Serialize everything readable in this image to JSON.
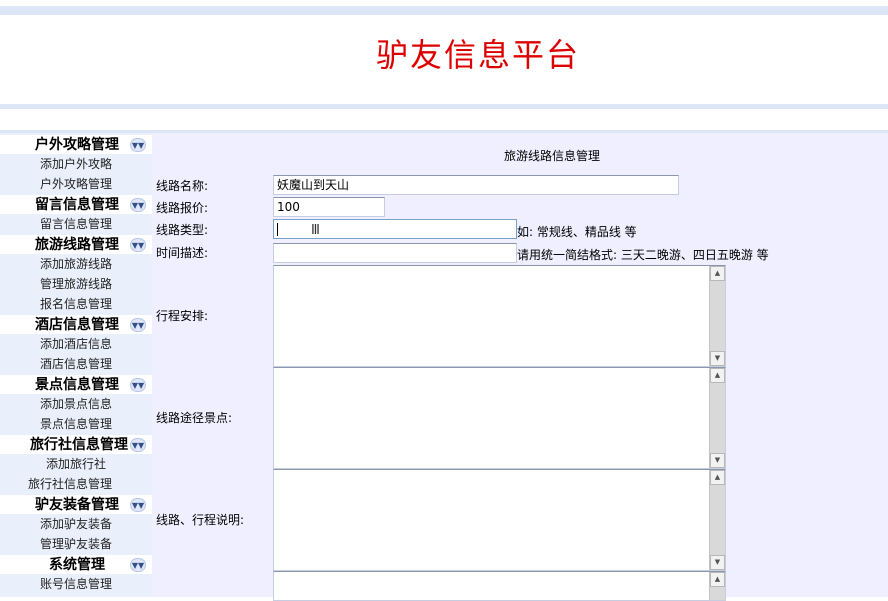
{
  "header": {
    "title": "驴友信息平台"
  },
  "sidebar": {
    "groups": [
      {
        "title": "户外攻略管理",
        "items": [
          "添加户外攻略",
          "户外攻略管理"
        ]
      },
      {
        "title": "留言信息管理",
        "items": [
          "留言信息管理"
        ]
      },
      {
        "title": "旅游线路管理",
        "items": [
          "添加旅游线路",
          "管理旅游线路",
          "报名信息管理"
        ]
      },
      {
        "title": "酒店信息管理",
        "items": [
          "添加酒店信息",
          "酒店信息管理"
        ]
      },
      {
        "title": "景点信息管理",
        "items": [
          "添加景点信息",
          "景点信息管理"
        ]
      },
      {
        "title": "旅行社信息管理",
        "items": [
          "添加旅行社",
          "旅行社信息管理"
        ]
      },
      {
        "title": "驴友装备管理",
        "items": [
          "添加驴友装备",
          "管理驴友装备"
        ]
      },
      {
        "title": "系统管理",
        "items": [
          "账号信息管理"
        ]
      }
    ],
    "toggle_icon": "double-chevron-down-icon"
  },
  "form": {
    "title": "旅游线路信息管理",
    "route_name_label": "线路名称:",
    "route_name_value": "妖魔山到天山",
    "price_label": "线路报价:",
    "price_value": "100",
    "type_label": "线路类型:",
    "type_value": "",
    "type_hint": "如: 常规线、精品线 等",
    "time_label": "时间描述:",
    "time_value": "",
    "time_hint": "请用统一简结格式: 三天二晚游、四日五晚游 等",
    "itinerary_label": "行程安排:",
    "spots_label": "线路途径景点:",
    "notes_label": "线路、行程说明:"
  },
  "colors": {
    "title_red": "#dd0000",
    "sidebar_bg": "#eaf0fb",
    "main_bg": "#efefff",
    "stripe": "#dde6f7"
  }
}
